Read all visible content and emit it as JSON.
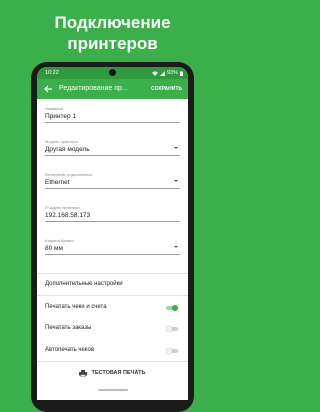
{
  "promo": {
    "title_line1": "Подключение",
    "title_line2": "принтеров"
  },
  "statusbar": {
    "time": "10:22",
    "battery": "93%"
  },
  "appbar": {
    "title": "Редактирование пр...",
    "save_label": "СОХРАНИТЬ"
  },
  "fields": {
    "name": {
      "label": "Название",
      "value": "Принтер 1"
    },
    "model": {
      "label": "Модель принтера",
      "value": "Другая модель"
    },
    "interface": {
      "label": "Интерфейс подключения",
      "value": "Ethernet"
    },
    "ip": {
      "label": "IP-адрес принтера",
      "value": "192.168.58.173"
    },
    "paper": {
      "label": "Ширина бумаги",
      "value": "80 мм"
    }
  },
  "settings": {
    "advanced_label": "Дополнительные настройки",
    "print_receipts_label": "Печатать чеки и счета",
    "print_receipts_on": true,
    "print_orders_label": "Печатать заказы",
    "print_orders_on": false,
    "autoprint_label": "Автопечать чеков",
    "autoprint_on": false
  },
  "test_print_label": "ТЕСТОВАЯ ПЕЧАТЬ",
  "colors": {
    "accent": "#3bb04a",
    "accent_dark": "#2e9a3c"
  }
}
